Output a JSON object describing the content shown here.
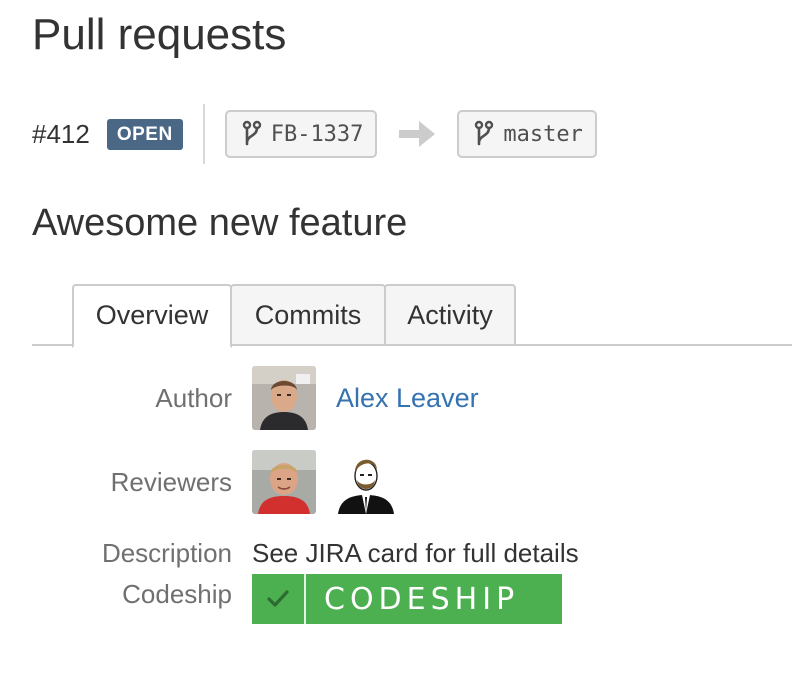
{
  "page": {
    "title": "Pull requests"
  },
  "pull_request": {
    "number": "#412",
    "status": "OPEN",
    "source_branch": "FB-1337",
    "target_branch": "master",
    "title": "Awesome new feature"
  },
  "tabs": [
    {
      "label": "Overview",
      "active": true
    },
    {
      "label": "Commits",
      "active": false
    },
    {
      "label": "Activity",
      "active": false
    }
  ],
  "details": {
    "author_label": "Author",
    "author_name": "Alex Leaver",
    "reviewers_label": "Reviewers",
    "description_label": "Description",
    "description_text": "See JIRA card for full details",
    "codeship_label": "Codeship",
    "codeship_badge_text": "CODESHIP"
  },
  "icons": {
    "branch": "branch-icon",
    "arrow": "arrow-right-icon",
    "check": "check-icon"
  },
  "colors": {
    "status_badge": "#4a6785",
    "link": "#3572b0",
    "codeship_green": "#4caf50"
  }
}
